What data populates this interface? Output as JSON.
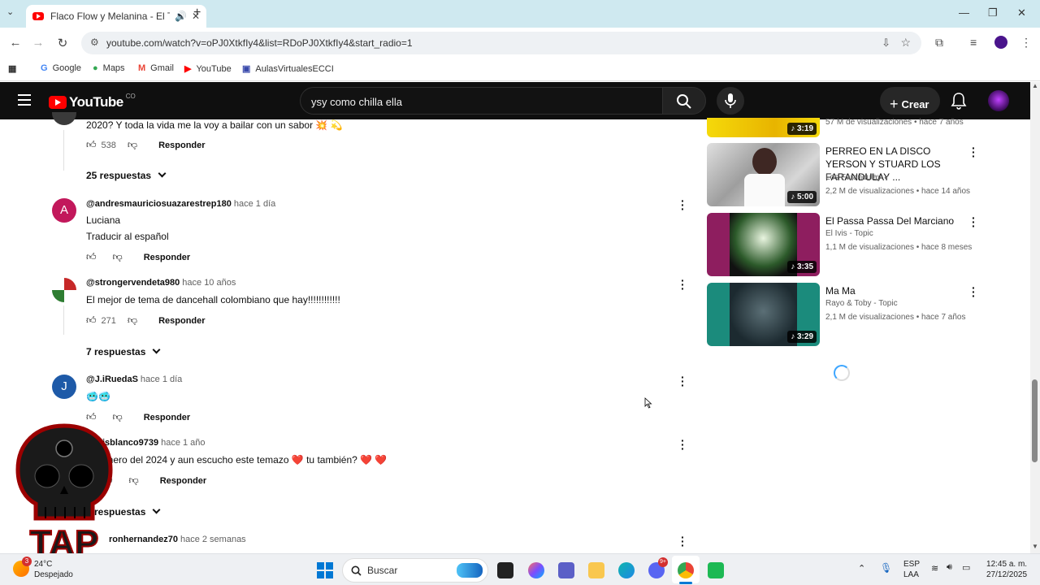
{
  "browser": {
    "tab_title": "Flaco Flow y Melanina - El T",
    "url": "youtube.com/watch?v=oPJ0XtkfIy4&list=RDoPJ0XtkfIy4&start_radio=1",
    "bookmarks": [
      {
        "label": "Google",
        "icon": "google-icon"
      },
      {
        "label": "Maps",
        "icon": "maps-icon"
      },
      {
        "label": "Gmail",
        "icon": "gmail-icon"
      },
      {
        "label": "YouTube",
        "icon": "youtube-icon"
      },
      {
        "label": "AulasVirtualesECCI",
        "icon": "aulas-icon"
      }
    ]
  },
  "youtube": {
    "logo_text": "YouTube",
    "country": "CO",
    "search_value": "ysy como chilla ella",
    "create_label": "Crear"
  },
  "comments": [
    {
      "handle": "",
      "time": "",
      "text": "2020? Y toda la vida me la voy a bailar con un sabor 💥 💫",
      "likes": "538",
      "reply": "Responder",
      "replies": "25 respuestas"
    },
    {
      "avatar_letter": "A",
      "avatar_color": "#c2185b",
      "handle": "@andresmauriciosuazarestrep180",
      "time": "hace 1 día",
      "text": "Luciana",
      "text2": "Traducir al español",
      "likes": "",
      "reply": "Responder"
    },
    {
      "handle": "@strongervendeta980",
      "time": "hace 10 años",
      "text": "El mejor de tema de dancehall colombiano que hay!!!!!!!!!!!!",
      "likes": "271",
      "reply": "Responder",
      "replies": "7 respuestas"
    },
    {
      "avatar_letter": "J",
      "avatar_color": "#1e5aa8",
      "handle": "@J.iRuedaS",
      "time": "hace 1 día",
      "text": "🥶🥶",
      "likes": "",
      "reply": "Responder"
    },
    {
      "handle": "isblanco9739",
      "time": "hace 1 año",
      "text": "enero del 2024 y aun escucho este temazo ❤️ tu también? ❤️ ❤️",
      "likes": "",
      "reply": "Responder",
      "replies": "3 respuestas"
    },
    {
      "handle": "ronhernandez70",
      "time": "hace 2 semanas"
    }
  ],
  "videos": [
    {
      "duration": "3:19",
      "meta": "57 M de visualizaciones • hace 7 años"
    },
    {
      "title": "PERREO EN LA DISCO YERSON Y STUARD LOS FARANDULAY ...",
      "channel": "Los Farandulay",
      "meta": "2,2 M de visualizaciones • hace 14 años",
      "duration": "5:00"
    },
    {
      "title": "El Passa Passa Del Marciano",
      "channel": "El Ivis - Topic",
      "meta": "1,1 M de visualizaciones • hace 8 meses",
      "duration": "3:35"
    },
    {
      "title": "Ma Ma",
      "channel": "Rayo & Toby - Topic",
      "meta": "2,1 M de visualizaciones • hace 7 años",
      "duration": "3:29"
    }
  ],
  "watermark": {
    "text": "TAP"
  },
  "taskbar": {
    "temperature": "24°C",
    "weather": "Despejado",
    "weather_badge": "3",
    "search_placeholder": "Buscar",
    "lang1": "ESP",
    "lang2": "LAA",
    "time": "12:45 a. m.",
    "date": "27/12/2025",
    "discord_badge": "9+"
  }
}
